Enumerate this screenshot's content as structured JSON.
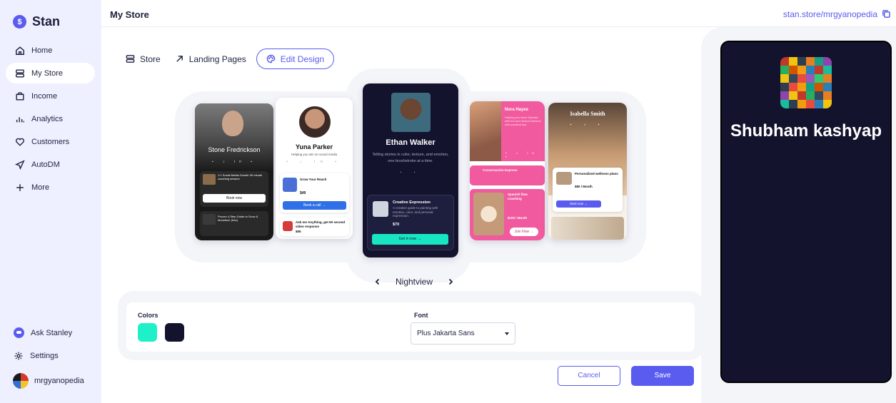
{
  "brand": {
    "name": "Stan",
    "logo_glyph": "$"
  },
  "sidebar": {
    "items": [
      {
        "label": "Home",
        "icon": "home-icon"
      },
      {
        "label": "My Store",
        "icon": "store-icon",
        "active": true
      },
      {
        "label": "Income",
        "icon": "wallet-icon"
      },
      {
        "label": "Analytics",
        "icon": "analytics-icon"
      },
      {
        "label": "Customers",
        "icon": "heart-icon"
      },
      {
        "label": "AutoDM",
        "icon": "send-icon"
      },
      {
        "label": "More",
        "icon": "plus-icon"
      }
    ],
    "bottom": [
      {
        "label": "Ask Stanley",
        "icon": "stanley-icon"
      },
      {
        "label": "Settings",
        "icon": "gear-icon"
      }
    ],
    "user": {
      "name": "mrgyanopedia"
    }
  },
  "header": {
    "title": "My Store",
    "store_url": "stan.store/mrgyanopedia"
  },
  "tabs": [
    {
      "label": "Store",
      "icon": "stack-icon"
    },
    {
      "label": "Landing Pages",
      "icon": "arrow-up-right-icon"
    },
    {
      "label": "Edit Design",
      "icon": "palette-icon",
      "active": true
    }
  ],
  "themes": {
    "current": "Nightview",
    "cards": [
      {
        "name": "Stone Fredrickson",
        "items": [
          "1:1 Social Media Growth 30 minute coaching session",
          "Proven 4-Step Guide to Grow & Monetize! (free)"
        ],
        "button": "Book now"
      },
      {
        "name": "Yuna Parker",
        "sub": "Helping you win on social media",
        "items": [
          "Grow Your Reach",
          "Ask me Anything, get 60 second video response"
        ],
        "price": "$49",
        "price2": "$65",
        "button": "Book a call →"
      },
      {
        "name": "Ethan Walker",
        "sub": "Telling stories in color, texture, and emotion, one brushstroke at a time.",
        "item": "Creative Expression",
        "item_sub": "A creative guide to painting with emotion, color, and personal expression.",
        "price": "$70",
        "button": "Get it now →"
      },
      {
        "name": "Nora Hayes",
        "sub": "Helping you learn Spanish with fun and relaxed lessons with practical tips",
        "items": [
          "Conversación Express",
          "Spanish flow coaching"
        ],
        "price": "$100 / Month",
        "button": "Join Now →"
      },
      {
        "name": "Isabella Smith",
        "item": "Personalized wellness plans",
        "price": "$80 / Month",
        "button": "Start now →"
      }
    ]
  },
  "design": {
    "colors_label": "Colors",
    "font_label": "Font",
    "colors": [
      "#1ef0c8",
      "#13132e"
    ],
    "font_value": "Plus Jakarta Sans"
  },
  "actions": {
    "cancel": "Cancel",
    "save": "Save"
  },
  "preview": {
    "name": "Shubham kashyap",
    "bg": "#13132e"
  },
  "accent": "#5a5cf0"
}
